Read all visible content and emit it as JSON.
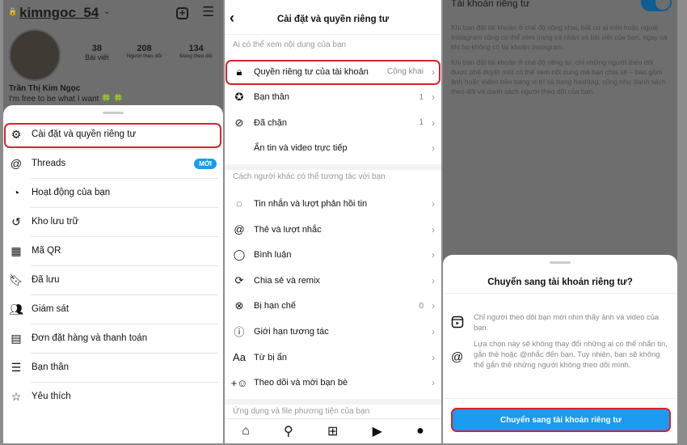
{
  "profile": {
    "username": "kimngoc_54",
    "stats": [
      {
        "value": "38",
        "label": "Bài viết"
      },
      {
        "value": "208",
        "label": "Người theo dõi"
      },
      {
        "value": "134",
        "label": "Đang theo dõi"
      }
    ],
    "name": "Trần Thị Kim Ngọc",
    "bio": "I'm free to be what I want 🍀 🍀"
  },
  "menu": {
    "items": [
      {
        "label": "Cài đặt và quyền riêng tư",
        "icon": "settings-icon"
      },
      {
        "label": "Threads",
        "icon": "threads-icon",
        "badge": "MỚI"
      },
      {
        "label": "Hoạt động của bạn",
        "icon": "activity-icon"
      },
      {
        "label": "Kho lưu trữ",
        "icon": "archive-icon"
      },
      {
        "label": "Mã QR",
        "icon": "qr-icon"
      },
      {
        "label": "Đã lưu",
        "icon": "bookmark-icon"
      },
      {
        "label": "Giám sát",
        "icon": "supervision-icon"
      },
      {
        "label": "Đơn đặt hàng và thanh toán",
        "icon": "card-icon"
      },
      {
        "label": "Bạn thân",
        "icon": "list-icon"
      },
      {
        "label": "Yêu thích",
        "icon": "star-icon"
      }
    ],
    "accent": "#1a9bf0",
    "highlight": "#d8232a"
  },
  "settings": {
    "title": "Cài đặt và quyền riêng tư",
    "sections": [
      {
        "label": "Ai có thể xem nội dung của bạn",
        "items": [
          {
            "label": "Quyền riêng tư của tài khoản",
            "value": "Công khai",
            "icon": "lock-icon"
          },
          {
            "label": "Bạn thân",
            "value": "1",
            "icon": "star-circle-icon"
          },
          {
            "label": "Đã chặn",
            "value": "1",
            "icon": "blocked-icon"
          },
          {
            "label": "Ẩn tin và video trực tiếp",
            "value": "",
            "icon": ""
          }
        ]
      },
      {
        "label": "Cách người khác có thể tương tác với bạn",
        "items": [
          {
            "label": "Tin nhắn và lượt phản hồi tin",
            "value": "",
            "icon": "messenger-icon"
          },
          {
            "label": "Thẻ và lượt nhắc",
            "value": "",
            "icon": "at-icon"
          },
          {
            "label": "Bình luận",
            "value": "",
            "icon": "comment-icon"
          },
          {
            "label": "Chia sẻ và remix",
            "value": "",
            "icon": "share-icon"
          },
          {
            "label": "Bị hạn chế",
            "value": "0",
            "icon": "restricted-icon"
          },
          {
            "label": "Giới hạn tương tác",
            "value": "",
            "icon": "limit-icon"
          },
          {
            "label": "Từ bị ẩn",
            "value": "",
            "icon": "text-icon"
          },
          {
            "label": "Theo dõi và mời bạn bè",
            "value": "",
            "icon": "add-person-icon"
          }
        ]
      },
      {
        "label": "Ứng dụng và file phương tiện của bạn",
        "items": []
      }
    ],
    "nav": [
      "home-icon",
      "search-icon",
      "create-icon",
      "reels-icon",
      "profile-icon"
    ]
  },
  "private": {
    "heading": "Tài khoản riêng tư",
    "toggle_on": true,
    "para1": "Khi bạn đặt tài khoản ở chế độ công khai, bất cứ ai trên hoặc ngoài Instagram cũng có thể xem trang cá nhân và bài viết của bạn, ngay cả khi họ không có tài khoản Instagram.",
    "para2": "Khi bạn đặt tài khoản ở chế độ riêng tư, chỉ những người theo dõi được phê duyệt mới có thể xem nội dung mà bạn chia sẻ – bao gồm ảnh hoặc video trên trang vị trí và trang hashtag, cũng như danh sách theo dõi và danh sách người theo dõi của bạn.",
    "sheet": {
      "title": "Chuyển sang tài khoản riêng tư?",
      "info1": "Chỉ người theo dõi bạn mới nhìn thấy ảnh và video của bạn.",
      "info2": "Lựa chọn này sẽ không thay đổi những ai có thể nhắn tin, gắn thẻ hoặc @nhắc đến bạn. Tuy nhiên, bạn sẽ không thể gắn thẻ những người không theo dõi mình.",
      "button": "Chuyển sang tài khoản riêng tư"
    }
  }
}
